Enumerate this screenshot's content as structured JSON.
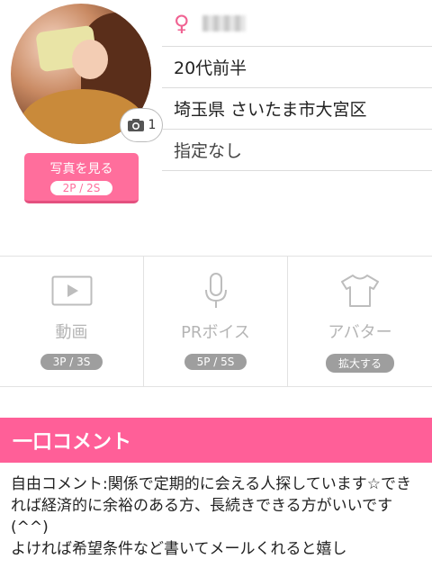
{
  "profile": {
    "photo_count": "1",
    "see_photo_label": "写真を見る",
    "see_photo_price": "2P / 2S",
    "gender_symbol": "♀",
    "age": "20代前半",
    "location": "埼玉県 さいたま市大宮区",
    "preference": "指定なし"
  },
  "media": [
    {
      "label": "動画",
      "badge": "3P / 3S",
      "icon": "video-play-icon"
    },
    {
      "label": "PRボイス",
      "badge": "5P / 5S",
      "icon": "microphone-icon"
    },
    {
      "label": "アバター",
      "badge": "拡大する",
      "icon": "tshirt-icon"
    }
  ],
  "comment": {
    "title": "一口コメント",
    "text": "自由コメント:関係で定期的に会える人探しています☆できれば経済的に余裕のある方、長続きできる方がいいです(^^)\nよければ希望条件など書いてメールくれると嬉し"
  },
  "colors": {
    "accent_pink": "#ff5f98",
    "button_pink": "#ff6e9c",
    "badge_gray": "#9e9e9e"
  }
}
